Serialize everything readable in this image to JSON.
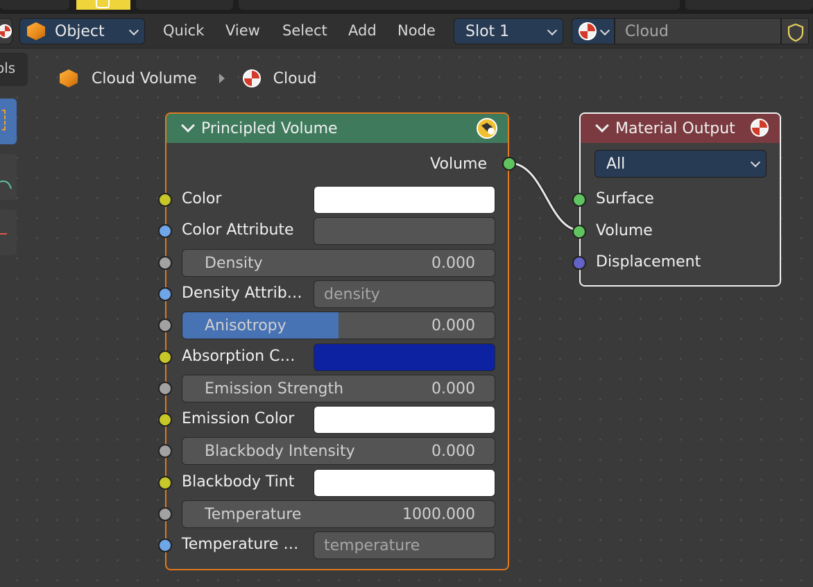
{
  "header": {
    "mode_label": "Object",
    "menus": [
      "Quick",
      "View",
      "Select",
      "Add",
      "Node"
    ],
    "slot_label": "Slot 1",
    "material_name": "Cloud"
  },
  "toolbar": {
    "tab_label": "ols"
  },
  "breadcrumb": {
    "object": "Cloud Volume",
    "material": "Cloud"
  },
  "principled_volume": {
    "title": "Principled Volume",
    "output": "Volume",
    "inputs": [
      {
        "label": "Color",
        "type": "color",
        "color": "#ffffff",
        "socket": "yellow"
      },
      {
        "label": "Color Attribute",
        "type": "attr",
        "value": "",
        "socket": "blue"
      },
      {
        "label": "Density",
        "type": "number",
        "value": "0.000",
        "socket": "grey"
      },
      {
        "label": "Density Attrib…",
        "type": "attr",
        "value": "density",
        "socket": "blue"
      },
      {
        "label": "Anisotropy",
        "type": "number",
        "value": "0.000",
        "fill": 0.5,
        "socket": "grey"
      },
      {
        "label": "Absorption C…",
        "type": "color",
        "color": "#0c22a0",
        "socket": "yellow"
      },
      {
        "label": "Emission Strength",
        "type": "number",
        "value": "0.000",
        "socket": "grey"
      },
      {
        "label": "Emission Color",
        "type": "color",
        "color": "#ffffff",
        "socket": "yellow"
      },
      {
        "label": "Blackbody Intensity",
        "type": "number",
        "value": "0.000",
        "socket": "grey"
      },
      {
        "label": "Blackbody Tint",
        "type": "color",
        "color": "#ffffff",
        "socket": "yellow"
      },
      {
        "label": "Temperature",
        "type": "number",
        "value": "1000.000",
        "socket": "grey"
      },
      {
        "label": "Temperature …",
        "type": "attr",
        "value": "temperature",
        "socket": "blue"
      }
    ]
  },
  "material_output": {
    "title": "Material Output",
    "target": "All",
    "inputs": [
      {
        "label": "Surface",
        "socket": "green"
      },
      {
        "label": "Volume",
        "socket": "green"
      },
      {
        "label": "Displacement",
        "socket": "purple"
      }
    ]
  },
  "colors": {
    "pv_header": "#3f7a5c",
    "mo_header": "#7a3a40",
    "pv_border": "#e0791e",
    "anisotropy_fill": "#4772b3"
  }
}
